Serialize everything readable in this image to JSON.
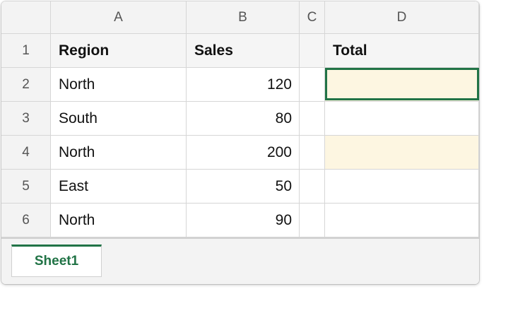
{
  "columns": {
    "a": "A",
    "b": "B",
    "c": "C",
    "d": "D"
  },
  "rows": [
    {
      "num": "1",
      "a": "Region",
      "b": "Sales",
      "c": "",
      "d": "Total"
    },
    {
      "num": "2",
      "a": "North",
      "b": "120",
      "c": "",
      "d": ""
    },
    {
      "num": "3",
      "a": "South",
      "b": "80",
      "c": "",
      "d": ""
    },
    {
      "num": "4",
      "a": "North",
      "b": "200",
      "c": "",
      "d": ""
    },
    {
      "num": "5",
      "a": "East",
      "b": "50",
      "c": "",
      "d": ""
    },
    {
      "num": "6",
      "a": "North",
      "b": "90",
      "c": "",
      "d": ""
    }
  ],
  "sheet_tab": "Sheet1",
  "colors": {
    "accent": "#217346",
    "highlight": "#fdf6e1"
  }
}
